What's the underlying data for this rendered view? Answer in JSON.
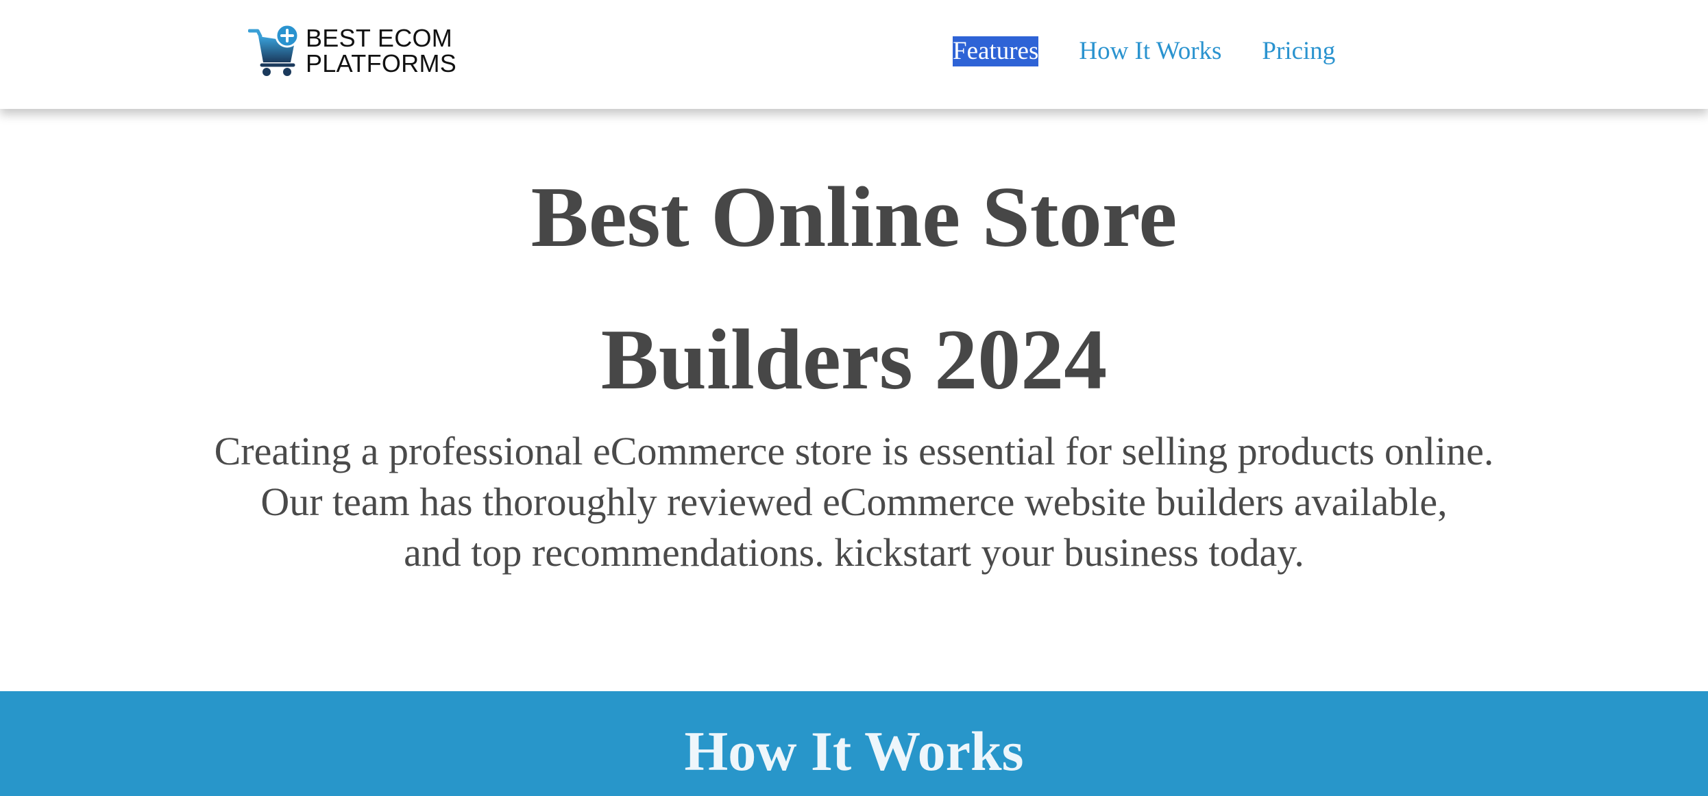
{
  "brand": {
    "line1": "BEST ECOM",
    "line2": "PLATFORMS",
    "icon": "cart-plus-icon",
    "icon_color_light": "#3a9fd6",
    "icon_color_dark": "#1b3a5c"
  },
  "nav": {
    "items": [
      {
        "label": "Features",
        "selected": true
      },
      {
        "label": "How It Works",
        "selected": false
      },
      {
        "label": "Pricing",
        "selected": false
      }
    ],
    "link_color": "#2a93cf",
    "selection_color": "#2e63d6"
  },
  "hero": {
    "title_line1": "Best Online Store",
    "title_line2": "Builders 2024",
    "subtitle_lines": [
      "Creating a professional eCommerce store is essential for selling products online.",
      "Our team has thoroughly reviewed eCommerce website builders available,",
      "and top recommendations. kickstart your business today."
    ],
    "text_color": "#474747"
  },
  "how_it_works": {
    "title": "How It Works",
    "background_color": "#2896ca"
  }
}
